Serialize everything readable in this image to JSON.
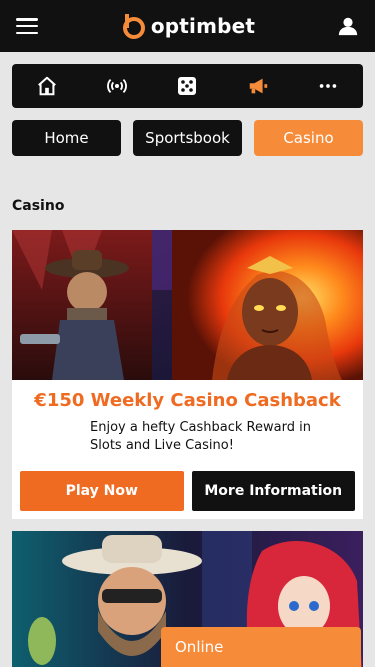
{
  "header": {
    "logo_text": "optimbet",
    "menu_icon": "hamburger-icon",
    "user_icon": "user-icon",
    "brand_color": "#f68b3a"
  },
  "icon_nav": [
    {
      "icon": "home-icon"
    },
    {
      "icon": "live-broadcast-icon"
    },
    {
      "icon": "dice-icon"
    },
    {
      "icon": "megaphone-icon",
      "active": true
    },
    {
      "icon": "more-icon"
    }
  ],
  "tabs": [
    {
      "label": "Home",
      "active": false
    },
    {
      "label": "Sportsbook",
      "active": false
    },
    {
      "label": "Casino",
      "active": true
    }
  ],
  "section": {
    "title": "Casino"
  },
  "promo": {
    "title": "€150 Weekly Casino Cashback",
    "description": "Enjoy a hefty Cashback Reward in Slots and Live Casino!",
    "primary_label": "Play Now",
    "secondary_label": "More Information"
  },
  "chat": {
    "label": "Online"
  }
}
